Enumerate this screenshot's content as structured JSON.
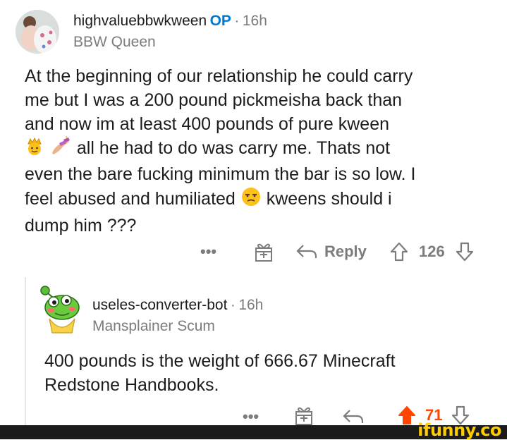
{
  "post": {
    "username": "highvaluebbwkween",
    "op_badge": "OP",
    "separator": "·",
    "time": "16h",
    "flair": "BBW Queen",
    "body_lines": [
      "At the beginning of our relationship he could carry",
      "me but I was a 200 pound pickmeisha back than",
      "and now im at least 400 pounds of pure kween"
    ],
    "body_line4": "all he had to do was carry me. Thats not",
    "body_line5": "even the bare fucking minimum the bar is so low. I",
    "body_line6a": "feel abused and humiliated",
    "body_line6b": "kweens should i",
    "body_line7": "dump him ???",
    "emojis": [
      "crown-face",
      "nail-polish",
      "unamused-face"
    ],
    "actions": {
      "more": "•••",
      "reply": "Reply",
      "score": "126"
    }
  },
  "reply": {
    "username": "useles-converter-bot",
    "separator": "·",
    "time": "16h",
    "flair": "Mansplainer Scum",
    "body_lines": [
      "400 pounds is the weight of 666.67 Minecraft",
      "Redstone Handbooks."
    ],
    "actions": {
      "more": "•••",
      "score": "71"
    }
  },
  "watermark": "ifunny.co",
  "colors": {
    "op": "#0079d3",
    "meta": "#7c7c7c",
    "upvote_active": "#ff4500",
    "watermark": "#ffcc00"
  }
}
